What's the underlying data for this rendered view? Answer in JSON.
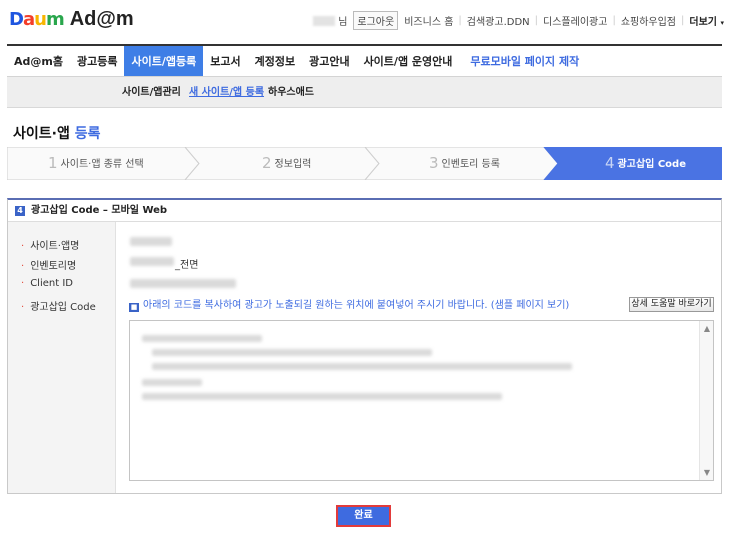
{
  "logo": {
    "brand": "Daum",
    "brand_parts": [
      "D",
      "a",
      "u",
      "m"
    ],
    "product": "Ad@m"
  },
  "util": {
    "user_suffix": "님",
    "logout": "로그아웃",
    "links": [
      "비즈니스 홈",
      "검색광고.DDN",
      "디스플레이광고",
      "쇼핑하우입점"
    ],
    "more": "더보기",
    "more_icon": "caret-down-icon"
  },
  "mainnav": {
    "items": [
      "Ad@m홈",
      "광고등록",
      "사이트/앱등록",
      "보고서",
      "계정정보",
      "광고안내",
      "사이트/앱 운영안내"
    ],
    "active": "사이트/앱등록",
    "promo": "무료모바일 페이지 제작"
  },
  "subnav": {
    "items": [
      "사이트/앱관리",
      "새 사이트/앱 등록",
      "하우스애드"
    ],
    "active": "새 사이트/앱 등록"
  },
  "page_title": {
    "main": "사이트·앱",
    "highlight": "등록"
  },
  "steps": [
    {
      "num": "1",
      "label": "사이트·앱 종류 선택"
    },
    {
      "num": "2",
      "label": "정보입력"
    },
    {
      "num": "3",
      "label": "인벤토리 등록"
    },
    {
      "num": "4",
      "label": "광고삽입 Code"
    }
  ],
  "active_step": 4,
  "panel": {
    "badge": "4",
    "title": "광고삽입 Code – 모바일 Web",
    "fields": [
      {
        "label": "사이트·앱명",
        "value": ""
      },
      {
        "label": "인벤토리명",
        "value": "_전면"
      },
      {
        "label": "Client ID",
        "value": ""
      },
      {
        "label": "광고삽입 Code",
        "value": ""
      }
    ],
    "notice_icon": "info-icon",
    "notice": "아래의 코드를 복사하여 광고가 노출되길 원하는 위치에 붙여넣어 주시기 바랍니다. (샘플 페이지 보기)",
    "help_button": "상세 도움말 바로가기"
  },
  "done_button": "완료",
  "colors": {
    "accent": "#3e6be0",
    "active_nav": "#3e7ee6",
    "highlight_border": "#e23b3b"
  }
}
